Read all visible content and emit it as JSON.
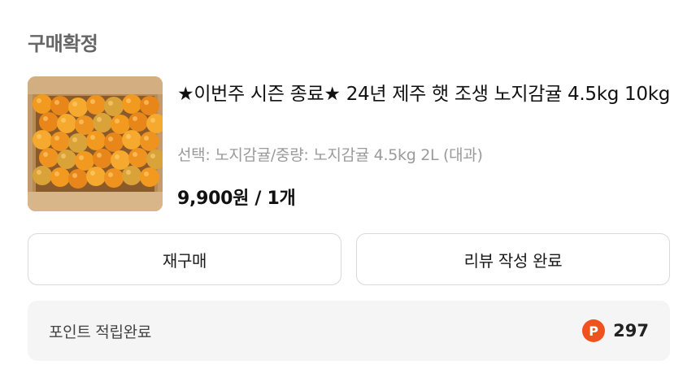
{
  "order": {
    "status": "구매확정",
    "product": {
      "image_desc": "orange-box-photo",
      "name": "★이번주 시즌 종료★ 24년 제주 햇 조생 노지감귤 4.5kg 10kg",
      "option": "선택: 노지감귤/중량: 노지감귤 4.5kg 2L (대과)",
      "price": "9,900원 / 1개"
    },
    "buttons": {
      "rebuy": "재구매",
      "review_done": "리뷰 작성 완료"
    },
    "points": {
      "label": "포인트 적립완료",
      "icon_letter": "P",
      "value": "297"
    }
  },
  "colors": {
    "point_icon": "#f0521f",
    "status_text": "#666666",
    "option_text": "#9a9a9a",
    "points_bg": "#f5f5f5"
  }
}
